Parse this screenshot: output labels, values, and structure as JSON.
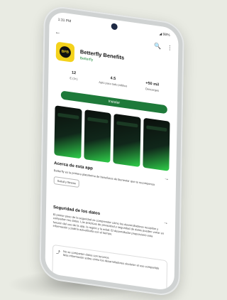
{
  "status": {
    "time": "1:31 PM",
    "icons": "◂ ◼ •",
    "right": "◢ 98%"
  },
  "appbar": {
    "back": "←",
    "search": "🔍",
    "more": "⋮"
  },
  "app": {
    "name": "Betterfly Benefits",
    "developer": "Betterfly",
    "logo_text": "BFB"
  },
  "stats": [
    {
      "value": "12",
      "label": "E (3+)"
    },
    {
      "value": "4.5",
      "label": "Apto para todo público"
    },
    {
      "value": "+50 mil",
      "label": "Descargas"
    }
  ],
  "install_label": "Instalar",
  "about": {
    "title": "Acerca de esta app",
    "arrow": "→",
    "desc": "Betterfly es la primera plataforma de beneficios de bienestar que te recompensa",
    "chip": "Salud y fitness"
  },
  "safety": {
    "title": "Seguridad de los datos",
    "arrow": "→",
    "desc": "El primer paso de la seguridad es comprender cómo los desarrolladores recopilan y comparten tus datos. Las prácticas de privacidad y seguridad de datos pueden variar en función del uso de la app, la región y la edad. El desarrollador proporcionó esta información y podría actualizarla con el tiempo."
  },
  "card": {
    "share_icon": "share-icon",
    "title": "No se comparten datos con terceros",
    "text": "Más información sobre cómo los desarrolladores declaran el uso compartido"
  }
}
